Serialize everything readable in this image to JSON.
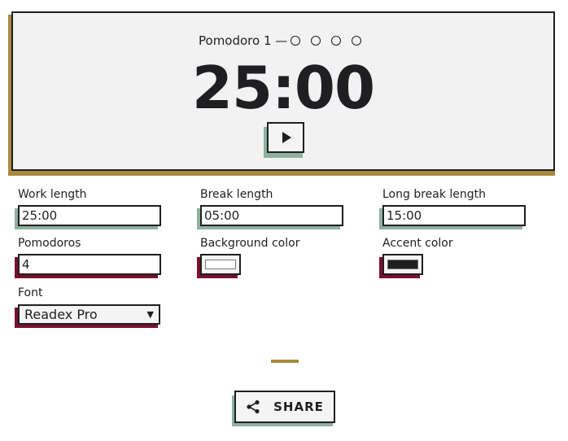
{
  "timer": {
    "cycle_label": "Pomodoro 1 —",
    "pomodoro_dots": [
      false,
      false,
      false,
      false
    ],
    "time": "25:00",
    "play_icon": "play-icon"
  },
  "settings": {
    "work_length": {
      "label": "Work length",
      "value": "25:00"
    },
    "break_length": {
      "label": "Break length",
      "value": "05:00"
    },
    "long_break_length": {
      "label": "Long break length",
      "value": "15:00"
    },
    "pomodoros": {
      "label": "Pomodoros",
      "value": "4"
    },
    "background_color": {
      "label": "Background color",
      "value": "#ffffff"
    },
    "accent_color": {
      "label": "Accent color",
      "value": "#1f1f22"
    },
    "font": {
      "label": "Font",
      "selected": "Readex Pro"
    }
  },
  "share": {
    "label": "SHARE",
    "icon": "share-icon"
  },
  "colors": {
    "gold_accent": "#a8893e",
    "sage_shadow": "#8fb0a0",
    "maroon_shadow": "#7a0f2e",
    "card_bg": "#f2f2f2",
    "ink": "#1f1f22"
  }
}
